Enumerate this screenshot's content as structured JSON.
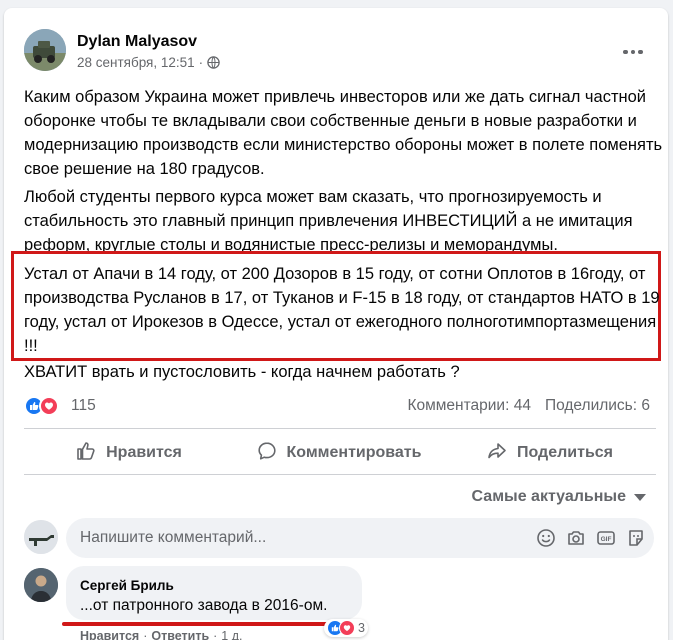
{
  "post": {
    "author": "Dylan Malyasov",
    "timestamp": "28 сентября, 12:51",
    "separator": "·",
    "privacy_icon": "globe-icon",
    "paragraphs": [
      "Каким образом Украина может привлечь инвесторов или же дать сигнал частной оборонке чтобы те вкладывали свои собственные деньги в новые разработки и модернизацию производств если министерство обороны может в полете поменять свое решение на 180 градусов.",
      "Любой студенты первого курса может вам сказать, что прогнозируемость и стабильность это главный принцип привлечения ИНВЕСТИЦИЙ а не имитация реформ, круглые столы и водянистые пресс-релизы и меморандумы.",
      "Устал от Апачи в 14 году, от 200 Дозоров в 15 году, от сотни Оплотов в 16году, от производства Русланов в 17, от Туканов и F-15 в 18 году, от стандартов НАТО в 19 году, устал от Ирокезов в Одессе, устал от ежегодного полноготимпортазмещения !!!",
      "ХВАТИТ врать и пустословить - когда начнем работать ?"
    ],
    "highlight_color": "#d01818"
  },
  "reactions": {
    "count": "115",
    "types": [
      "like-icon",
      "love-icon"
    ],
    "comments": "Комментарии: 44",
    "shares": "Поделились: 6"
  },
  "actions": {
    "like": "Нравится",
    "comment": "Комментировать",
    "share": "Поделиться"
  },
  "sort": {
    "label": "Самые актуальные"
  },
  "composer": {
    "placeholder": "Напишите комментарий...",
    "icons": [
      "emoji-icon",
      "camera-icon",
      "gif-icon",
      "sticker-icon"
    ]
  },
  "comment": {
    "author": "Сергей Бриль",
    "text": "...от патронного завода в 2016-ом.",
    "like": "Нравится",
    "reply": "Ответить",
    "dot": "·",
    "age": "1 д.",
    "reaction_count": "3"
  },
  "colors": {
    "accent": "#1877f2",
    "love": "#f33e58",
    "highlight": "#d01818"
  }
}
